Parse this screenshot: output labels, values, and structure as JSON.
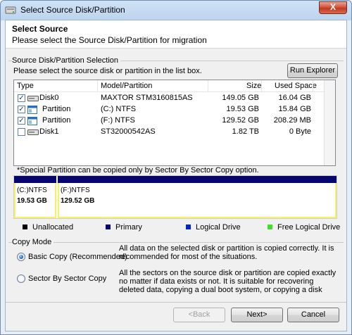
{
  "window": {
    "title": "Select Source Disk/Partition",
    "close_label": "X"
  },
  "header": {
    "title": "Select Source",
    "subtitle": "Please select the Source Disk/Partition for migration"
  },
  "selection_group": {
    "label": "Source Disk/Partition Selection",
    "instruction": "Please select the source disk or partition in the list box.",
    "run_explorer_label": "Run Explorer"
  },
  "table": {
    "columns": [
      "Type",
      "Model/Partition",
      "Size",
      "Used Space"
    ],
    "rows": [
      {
        "checked": true,
        "kind": "disk",
        "type": "Disk0",
        "model": "MAXTOR STM3160815AS",
        "size": "149.05 GB",
        "used": "16.04 GB"
      },
      {
        "checked": true,
        "kind": "partition",
        "type": "Partition",
        "model": "(C:)  NTFS",
        "size": "19.53 GB",
        "used": "15.84 GB"
      },
      {
        "checked": true,
        "kind": "partition",
        "type": "Partition",
        "model": "(F:)  NTFS",
        "size": "129.52 GB",
        "used": "208.29 MB"
      },
      {
        "checked": false,
        "kind": "disk",
        "type": "Disk1",
        "model": "ST32000542AS",
        "size": "1.82 TB",
        "used": "0 Byte"
      }
    ]
  },
  "note": "*Special Partition can be copied only by Sector By Sector Copy option.",
  "disk_map": {
    "segments": [
      {
        "name": "(C:)NTFS",
        "size": "19.53 GB"
      },
      {
        "name": "(F:)NTFS",
        "size": "129.52 GB"
      }
    ]
  },
  "legend": [
    {
      "label": "Unallocated",
      "color": "#000000"
    },
    {
      "label": "Primary",
      "color": "#06066e"
    },
    {
      "label": "Logical Drive",
      "color": "#0026c9"
    },
    {
      "label": "Free Logical Drive",
      "color": "#3ee02a"
    }
  ],
  "copy_mode": {
    "label": "Copy Mode",
    "options": [
      {
        "label": "Basic Copy (Recommended)",
        "selected": true,
        "description": "All data on the selected disk or partition is copied correctly. It is recommended for most of the situations."
      },
      {
        "label": "Sector By Sector Copy",
        "selected": false,
        "description": "All the sectors on the source disk or partition are copied exactly no matter if data exists or not. It is suitable for recovering deleted data, copying a dual boot system, or copying a disk that has a hidden"
      }
    ]
  },
  "footer": {
    "back_label": "<Back",
    "next_label": "Next>",
    "cancel_label": "Cancel"
  }
}
